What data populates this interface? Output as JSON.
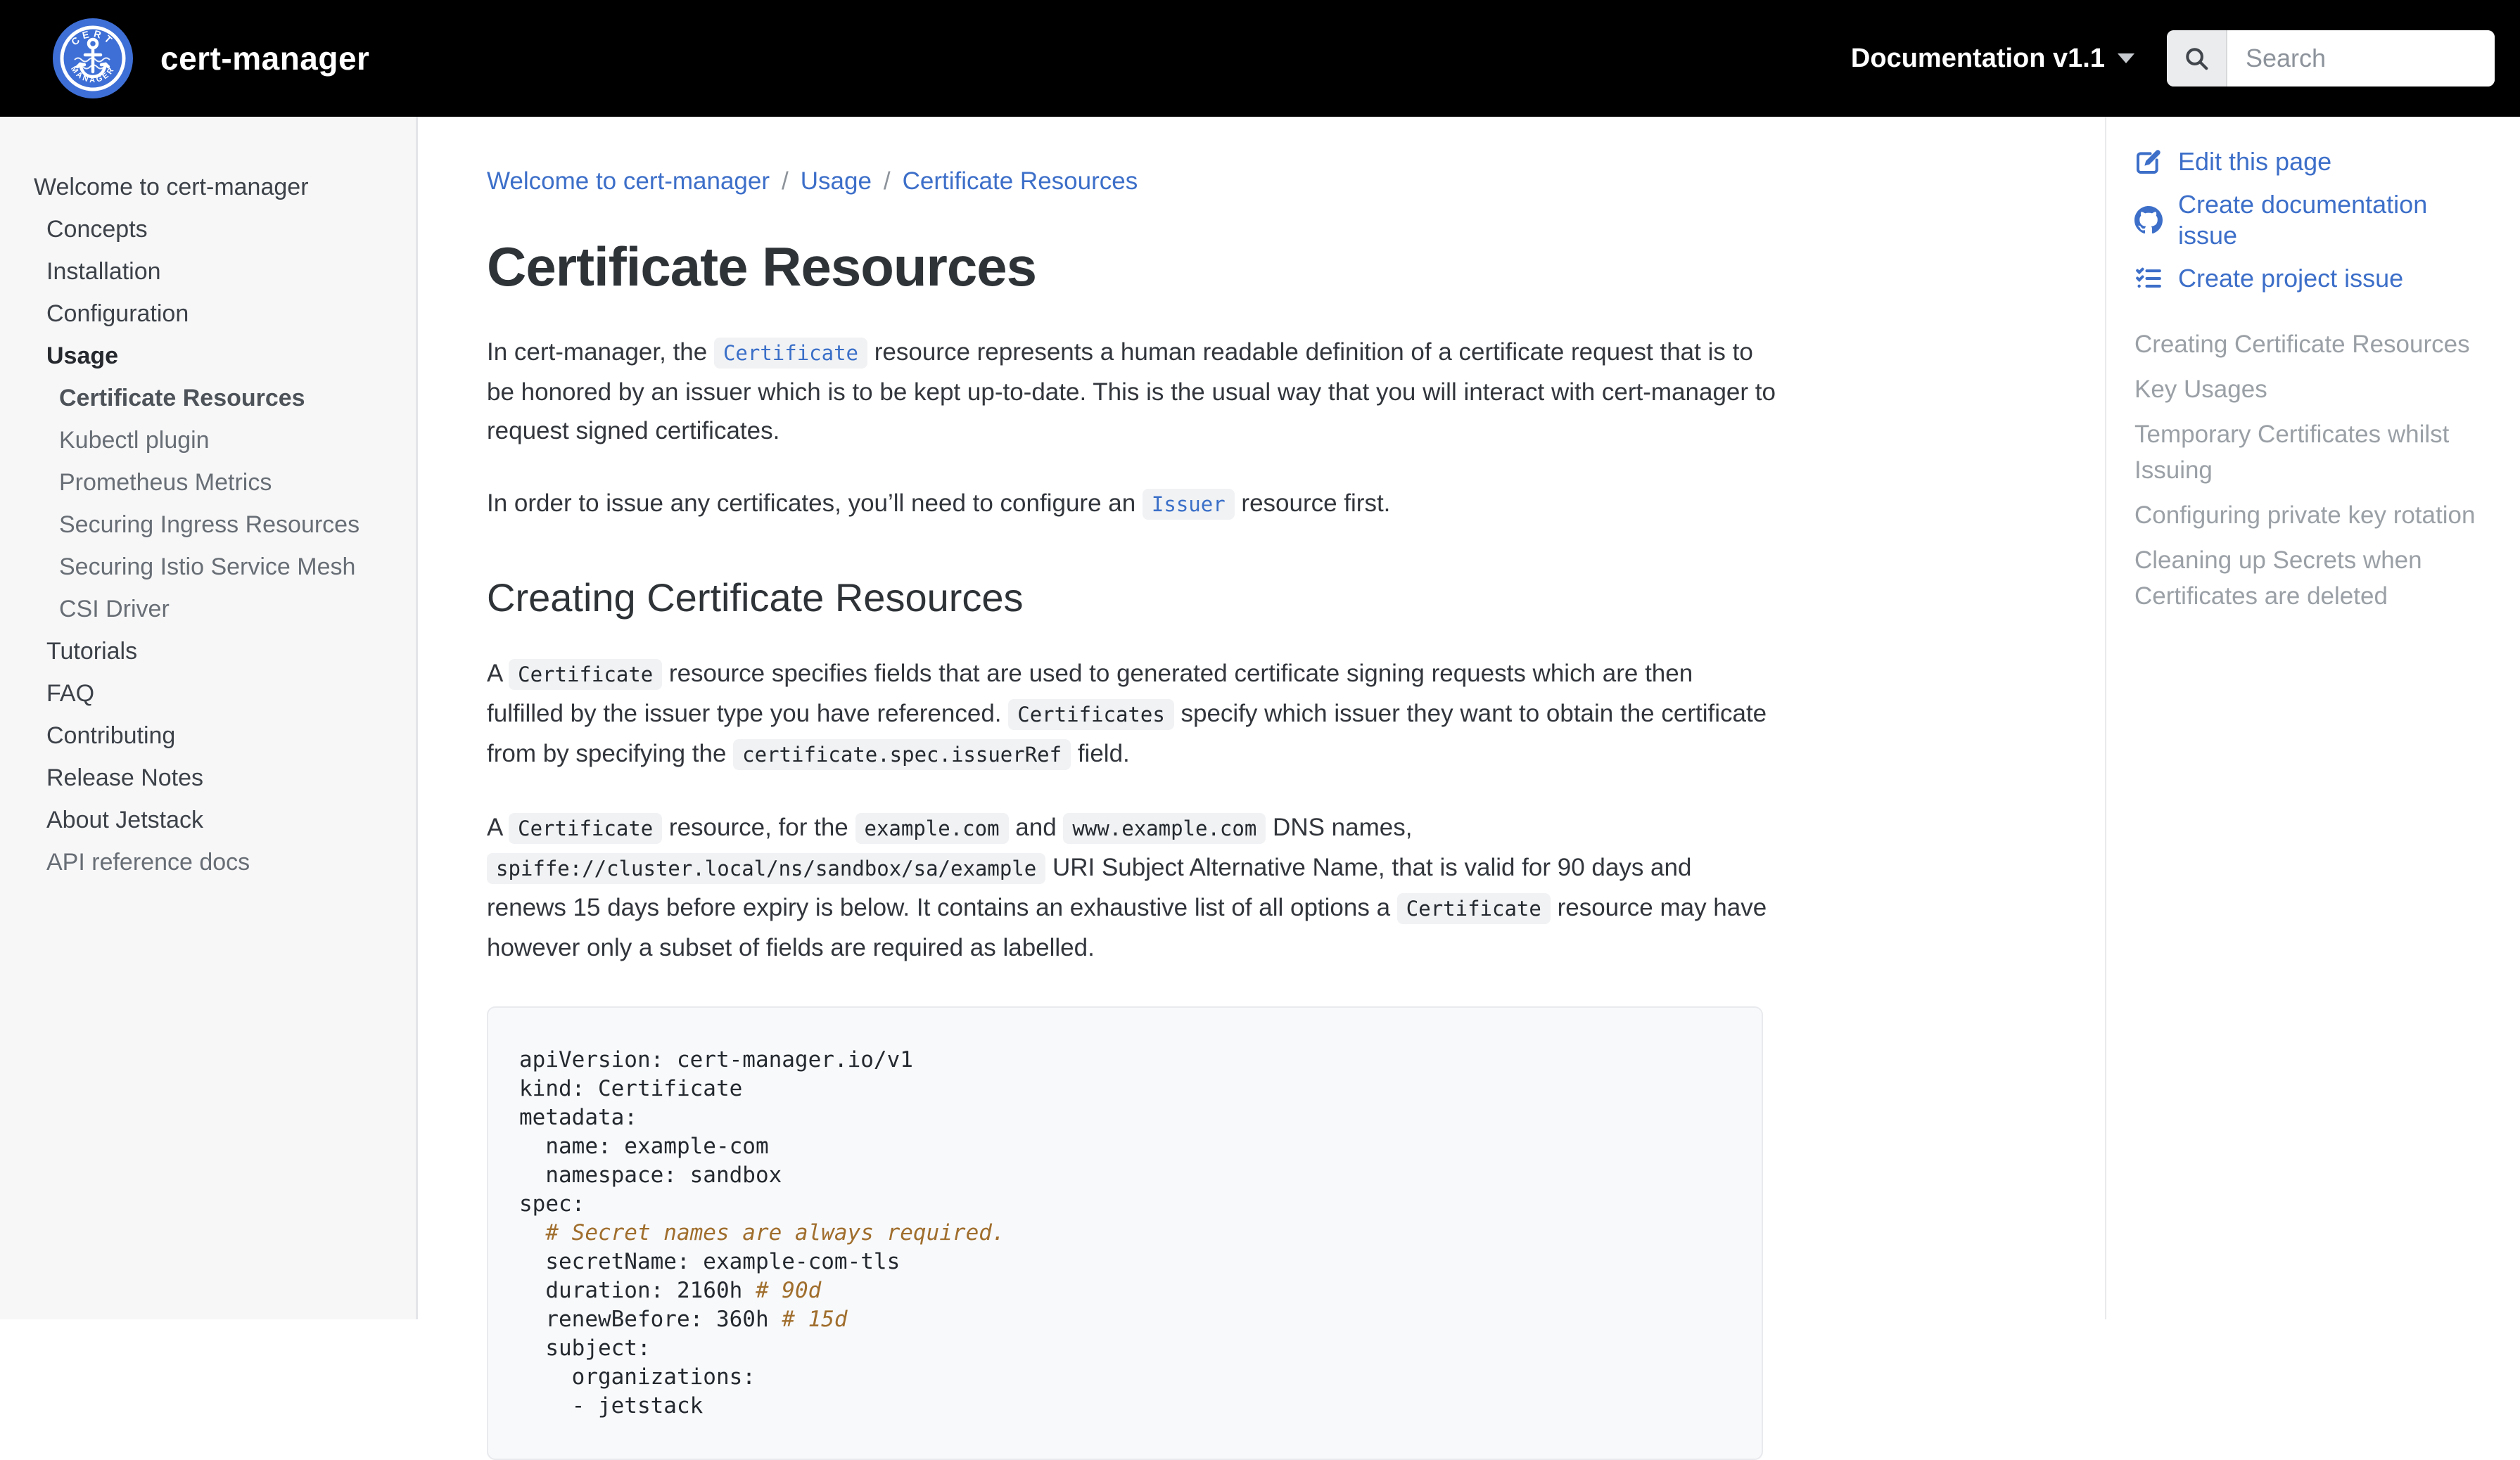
{
  "header": {
    "title": "cert-manager",
    "version_label": "Documentation v1.1",
    "search_placeholder": "Search"
  },
  "sidebar": {
    "items": [
      {
        "label": "Welcome to cert-manager",
        "level": 0
      },
      {
        "label": "Concepts",
        "level": 1
      },
      {
        "label": "Installation",
        "level": 1
      },
      {
        "label": "Configuration",
        "level": 1
      },
      {
        "label": "Usage",
        "level": 1,
        "bold": true
      },
      {
        "label": "Certificate Resources",
        "level": 2,
        "bold": true,
        "active": true
      },
      {
        "label": "Kubectl plugin",
        "level": 2,
        "muted": true
      },
      {
        "label": "Prometheus Metrics",
        "level": 2,
        "muted": true
      },
      {
        "label": "Securing Ingress Resources",
        "level": 2,
        "muted": true
      },
      {
        "label": "Securing Istio Service Mesh",
        "level": 2,
        "muted": true
      },
      {
        "label": "CSI Driver",
        "level": 2,
        "muted": true
      },
      {
        "label": "Tutorials",
        "level": 1
      },
      {
        "label": "FAQ",
        "level": 1
      },
      {
        "label": "Contributing",
        "level": 1
      },
      {
        "label": "Release Notes",
        "level": 1
      },
      {
        "label": "About Jetstack",
        "level": 1
      },
      {
        "label": "API reference docs",
        "level": 1,
        "muted": true
      }
    ]
  },
  "breadcrumb": {
    "separator": "/",
    "items": [
      "Welcome to cert-manager",
      "Usage",
      "Certificate Resources"
    ]
  },
  "content": {
    "title": "Certificate Resources",
    "intro_paragraphs": [
      [
        {
          "t": "text",
          "v": "In cert-manager, the "
        },
        {
          "t": "codelink",
          "v": "Certificate"
        },
        {
          "t": "text",
          "v": " resource represents a human readable definition of a certificate request that is to be honored by an issuer which is to be kept up-to-date. This is the usual way that you will interact with cert-manager to request signed certificates."
        }
      ],
      [
        {
          "t": "text",
          "v": "In order to issue any certificates, you’ll need to configure an "
        },
        {
          "t": "codelink",
          "v": "Issuer"
        },
        {
          "t": "text",
          "v": " resource first."
        }
      ]
    ],
    "section_heading": "Creating Certificate Resources",
    "section_paragraphs": [
      [
        {
          "t": "text",
          "v": "A "
        },
        {
          "t": "code",
          "v": "Certificate"
        },
        {
          "t": "text",
          "v": " resource specifies fields that are used to generated certificate signing requests which are then fulfilled by the issuer type you have referenced. "
        },
        {
          "t": "code",
          "v": "Certificates"
        },
        {
          "t": "text",
          "v": " specify which issuer they want to obtain the certificate from by specifying the "
        },
        {
          "t": "code",
          "v": "certificate.spec.issuerRef"
        },
        {
          "t": "text",
          "v": " field."
        }
      ],
      [
        {
          "t": "text",
          "v": "A "
        },
        {
          "t": "code",
          "v": "Certificate"
        },
        {
          "t": "text",
          "v": " resource, for the "
        },
        {
          "t": "code",
          "v": "example.com"
        },
        {
          "t": "text",
          "v": " and "
        },
        {
          "t": "code",
          "v": "www.example.com"
        },
        {
          "t": "text",
          "v": " DNS names, "
        },
        {
          "t": "code",
          "v": "spiffe://cluster.local/ns/sandbox/sa/example"
        },
        {
          "t": "text",
          "v": " URI Subject Alternative Name, that is valid for 90 days and renews 15 days before expiry is below. It contains an exhaustive list of all options a "
        },
        {
          "t": "code",
          "v": "Certificate"
        },
        {
          "t": "text",
          "v": " resource may have however only a subset of fields are required as labelled."
        }
      ]
    ],
    "code_block": {
      "language": "yaml",
      "lines": [
        {
          "parts": [
            {
              "t": "plain",
              "v": "apiVersion: cert-manager.io/v1"
            }
          ]
        },
        {
          "parts": [
            {
              "t": "plain",
              "v": "kind: Certificate"
            }
          ]
        },
        {
          "parts": [
            {
              "t": "plain",
              "v": "metadata:"
            }
          ]
        },
        {
          "parts": [
            {
              "t": "plain",
              "v": "  name: example-com"
            }
          ]
        },
        {
          "parts": [
            {
              "t": "plain",
              "v": "  namespace: sandbox"
            }
          ]
        },
        {
          "parts": [
            {
              "t": "plain",
              "v": "spec:"
            }
          ]
        },
        {
          "parts": [
            {
              "t": "plain",
              "v": "  "
            },
            {
              "t": "comment",
              "v": "# Secret names are always required."
            }
          ]
        },
        {
          "parts": [
            {
              "t": "plain",
              "v": "  secretName: example-com-tls"
            }
          ]
        },
        {
          "parts": [
            {
              "t": "plain",
              "v": "  duration: 2160h "
            },
            {
              "t": "comment",
              "v": "# 90d"
            }
          ]
        },
        {
          "parts": [
            {
              "t": "plain",
              "v": "  renewBefore: 360h "
            },
            {
              "t": "comment",
              "v": "# 15d"
            }
          ]
        },
        {
          "parts": [
            {
              "t": "plain",
              "v": "  subject:"
            }
          ]
        },
        {
          "parts": [
            {
              "t": "plain",
              "v": "    organizations:"
            }
          ]
        },
        {
          "parts": [
            {
              "t": "plain",
              "v": "    - jetstack"
            }
          ]
        }
      ]
    }
  },
  "page_tools": {
    "links": [
      {
        "icon": "edit-icon",
        "label": "Edit this page"
      },
      {
        "icon": "github-icon",
        "label": "Create documentation issue"
      },
      {
        "icon": "tasks-icon",
        "label": "Create project issue"
      }
    ],
    "toc": [
      "Creating Certificate Resources",
      "Key Usages",
      "Temporary Certificates whilst Issuing",
      "Configuring private key rotation",
      "Cleaning up Secrets when Certificates are deleted"
    ]
  },
  "colors": {
    "header_bg": "#000000",
    "link_blue": "#3d6fc9",
    "logo_blue": "#3e6fd6",
    "code_comment": "#a06e2d",
    "toc_gray": "#9aa0a6",
    "sidebar_bg": "#f7f7f8"
  }
}
